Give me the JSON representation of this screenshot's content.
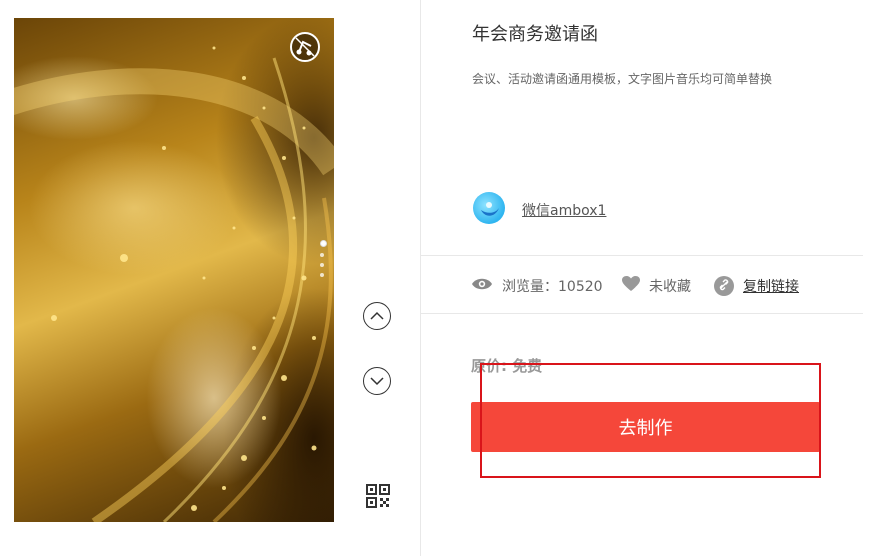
{
  "template": {
    "title": "年会商务邀请函",
    "description": "会议、活动邀请函通用模板，文字图片音乐均可简单替换"
  },
  "author": {
    "name": "微信ambox1"
  },
  "stats": {
    "views_label": "浏览量：10520",
    "favorite_label": "未收藏",
    "copy_link_label": "复制链接"
  },
  "pricing": {
    "price_label": "原价: 免费",
    "cta_label": "去制作"
  },
  "colors": {
    "cta": "#f5473a",
    "highlight": "#d9141a"
  },
  "icons": {
    "music": "music-note-icon",
    "prev": "chevron-up-icon",
    "next": "chevron-down-icon",
    "qr": "qr-code-icon",
    "views": "eye-icon",
    "favorite": "heart-icon",
    "link": "link-icon"
  }
}
